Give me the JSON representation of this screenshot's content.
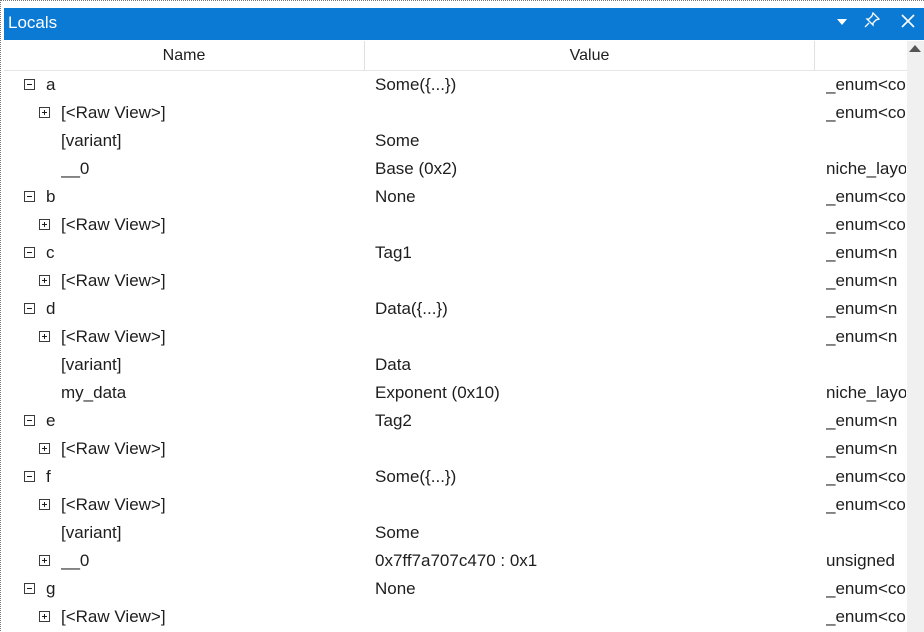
{
  "window": {
    "title": "Locals"
  },
  "columns": {
    "name": "Name",
    "value": "Value"
  },
  "icons": {
    "dropdown": "chevron-down-icon",
    "pin": "pin-icon",
    "close": "close-icon",
    "expand": "plus-box-icon",
    "collapse": "minus-box-icon"
  },
  "colors": {
    "titlebar": "#0a7ad4"
  },
  "rows": [
    {
      "name": "a",
      "value": "Some({...})",
      "type": "_enum<co"
    },
    {
      "name": "[<Raw View>]",
      "value": "",
      "type": "_enum<co"
    },
    {
      "name": "[variant]",
      "value": "Some",
      "type": ""
    },
    {
      "name": "__0",
      "value": "Base (0x2)",
      "type": "niche_layo"
    },
    {
      "name": "b",
      "value": "None",
      "type": "_enum<co"
    },
    {
      "name": "[<Raw View>]",
      "value": "",
      "type": "_enum<co"
    },
    {
      "name": "c",
      "value": "Tag1",
      "type": "_enum<n"
    },
    {
      "name": "[<Raw View>]",
      "value": "",
      "type": "_enum<n"
    },
    {
      "name": "d",
      "value": "Data({...})",
      "type": "_enum<n"
    },
    {
      "name": "[<Raw View>]",
      "value": "",
      "type": "_enum<n"
    },
    {
      "name": "[variant]",
      "value": "Data",
      "type": ""
    },
    {
      "name": "my_data",
      "value": "Exponent (0x10)",
      "type": "niche_layo"
    },
    {
      "name": "e",
      "value": "Tag2",
      "type": "_enum<n"
    },
    {
      "name": "[<Raw View>]",
      "value": "",
      "type": "_enum<n"
    },
    {
      "name": "f",
      "value": "Some({...})",
      "type": "_enum<co"
    },
    {
      "name": "[<Raw View>]",
      "value": "",
      "type": "_enum<co"
    },
    {
      "name": "[variant]",
      "value": "Some",
      "type": ""
    },
    {
      "name": "__0",
      "value": "0x7ff7a707c470 : 0x1",
      "type": "unsigned"
    },
    {
      "name": "g",
      "value": "None",
      "type": "_enum<co"
    },
    {
      "name": "[<Raw View>]",
      "value": "",
      "type": "_enum<co"
    }
  ]
}
